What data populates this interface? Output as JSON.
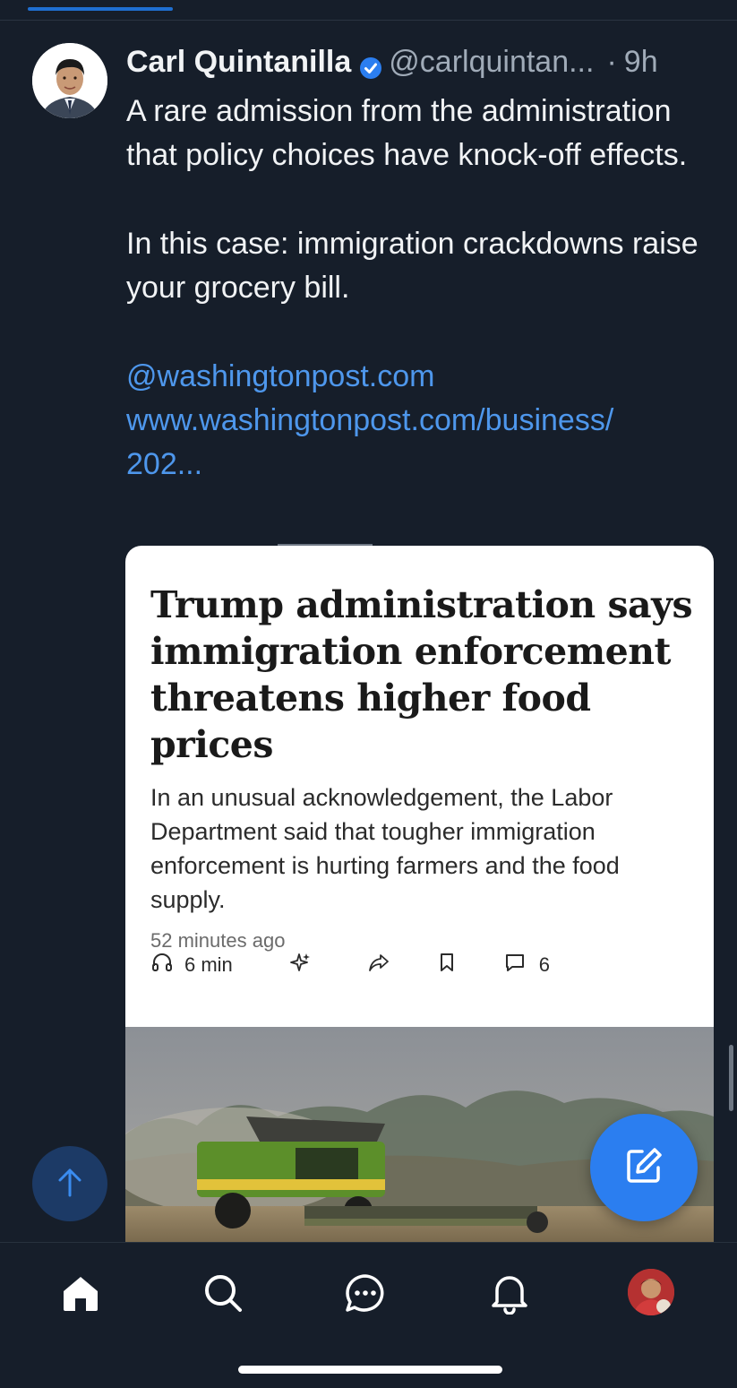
{
  "post": {
    "author_name": "Carl Quintanilla",
    "handle": "@carlquintan...",
    "separator": "·",
    "time": "9h",
    "text_p1": "A rare admission from the administration that policy choices have knock-off effects.",
    "text_p2": "In this case: immigration crackdowns raise your grocery bill.",
    "link_handle": "@washingtonpost.com",
    "link_url_line1": "www.washingtonpost.com/business/",
    "link_url_line2": "202..."
  },
  "card": {
    "headline": "Trump administration says immigration enforcement threatens higher food prices",
    "summary": "In an unusual acknowledgement, the Labor Department said that tougher immigration enforcement is hurting farmers and the food supply.",
    "time_ago": "52 minutes ago",
    "listen_label": "6 min",
    "comments_count": "6"
  },
  "icons": {
    "verified": "verified-badge-icon",
    "listen": "headphones-icon",
    "ai": "sparkle-icon",
    "share": "share-arrow-icon",
    "bookmark": "bookmark-icon",
    "comment": "comment-icon",
    "scroll_top": "arrow-up-icon",
    "compose": "compose-icon",
    "nav_home": "home-icon",
    "nav_search": "search-icon",
    "nav_messages": "chat-icon",
    "nav_notifications": "bell-icon"
  },
  "colors": {
    "background": "#161e2a",
    "link": "#4e97ec",
    "accent": "#2b7ef0",
    "verified": "#2b7ef0"
  }
}
